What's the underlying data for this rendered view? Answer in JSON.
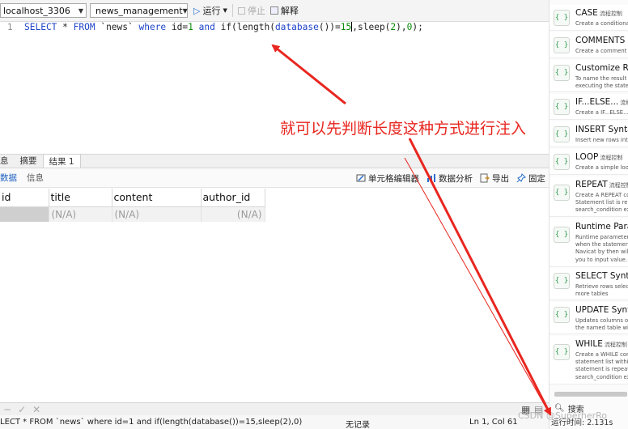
{
  "toolbar": {
    "connection": "localhost_3306",
    "database": "news_management",
    "run_label": "运行",
    "stop_label": "停止",
    "explain_label": "解释"
  },
  "editor": {
    "line_number": "1",
    "sql": "SELECT * FROM `news` where id=1 and if(length(database())=15,sleep(2),0);"
  },
  "annotation": "就可以先判断长度这种方式进行注入",
  "bottom_tabs": [
    "息",
    "摘要",
    "结果 1"
  ],
  "sub_tabs": [
    "数据",
    "信息"
  ],
  "grid_tools": {
    "cell_editor": "单元格编辑器",
    "data_analysis": "数据分析",
    "export": "导出",
    "pin": "固定"
  },
  "grid": {
    "columns": [
      "id",
      "title",
      "content",
      "author_id"
    ],
    "row": [
      "",
      "(N/A)",
      "(N/A)",
      "(N/A)"
    ]
  },
  "status": {
    "sql": "LECT * FROM `news` where id=1 and if(length(database())=15,sleep(2),0)",
    "record": "无记录",
    "position": "Ln 1, Col 61",
    "runtime": "运行时间: 2.131s"
  },
  "snippets": [
    {
      "title": "CASE",
      "tag": "流程控制",
      "desc": [
        "Create a conditional c"
      ]
    },
    {
      "title": "COMMENTS",
      "tag": "",
      "desc": [
        "Create a comment"
      ]
    },
    {
      "title": "Customize Re",
      "tag": "",
      "desc": [
        "To name the result ta",
        "executing the stateme"
      ]
    },
    {
      "title": "IF...ELSE...",
      "tag": "流程控制",
      "desc": [
        "Create a IF...ELSE... c"
      ]
    },
    {
      "title": "INSERT Syntax",
      "tag": "",
      "desc": [
        "Insert new rows into a"
      ]
    },
    {
      "title": "LOOP",
      "tag": "流程控制",
      "desc": [
        "Create a simple loop c"
      ]
    },
    {
      "title": "REPEAT",
      "tag": "流程控制",
      "desc": [
        "Create A REPEAT cons",
        "Statement list is repea",
        "search_condition exp"
      ]
    },
    {
      "title": "Runtime Param",
      "tag": "",
      "desc": [
        "Runtime parameter to",
        "when the statements",
        "Navicat by then will p",
        "you to input value."
      ]
    },
    {
      "title": "SELECT Syntax",
      "tag": "",
      "desc": [
        "Retrieve rows selecte",
        "more tables"
      ]
    },
    {
      "title": "UPDATE Syntax",
      "tag": "",
      "desc": [
        "Updates columns of e",
        "the named table with"
      ]
    },
    {
      "title": "WHILE",
      "tag": "流程控制",
      "desc": [
        "Create a WHILE consi",
        "statement list within a",
        "statement is repeated",
        "search_condition exp"
      ]
    }
  ],
  "right_search_placeholder": "搜索",
  "watermark": "CSDN @SuperherRo",
  "colors": {
    "annotation": "#e8261f",
    "keyword": "#1f45c9",
    "number": "#0a8a0a"
  }
}
